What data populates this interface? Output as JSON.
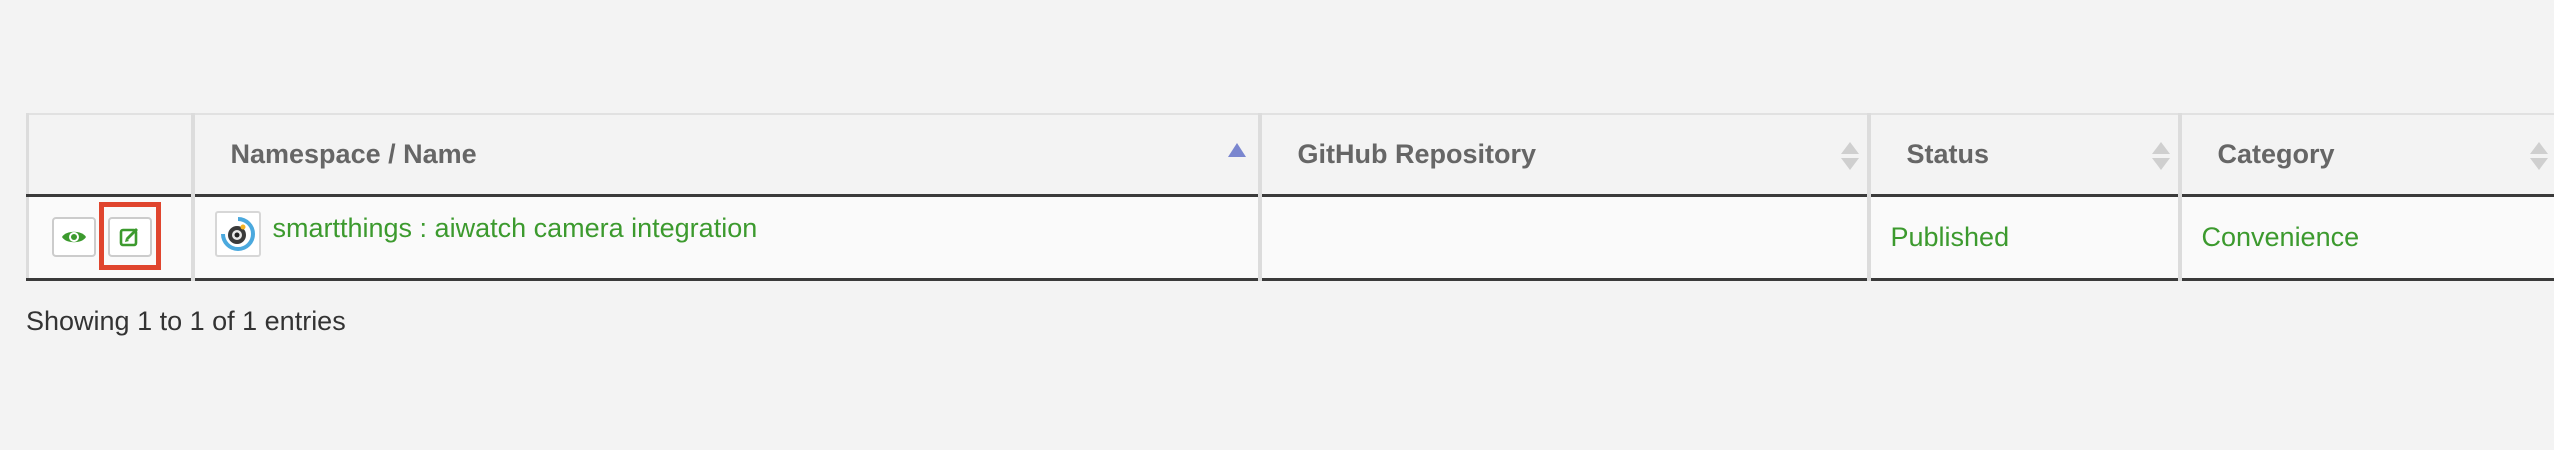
{
  "table": {
    "headers": {
      "actions": "",
      "namespace_name": "Namespace / Name",
      "github_repository": "GitHub Repository",
      "status": "Status",
      "category": "Category"
    },
    "rows": [
      {
        "name": "smartthings : aiwatch camera integration",
        "github_repository": "",
        "status": "Published",
        "category": "Convenience"
      }
    ]
  },
  "info": "Showing 1 to 1 of 1 entries",
  "colors": {
    "link_green": "#3c9a2e",
    "highlight_red": "#e0452e",
    "sort_active": "#7a86cf"
  },
  "icons": {
    "view": "eye-icon",
    "edit": "edit-icon",
    "app": "camera-app-icon"
  }
}
